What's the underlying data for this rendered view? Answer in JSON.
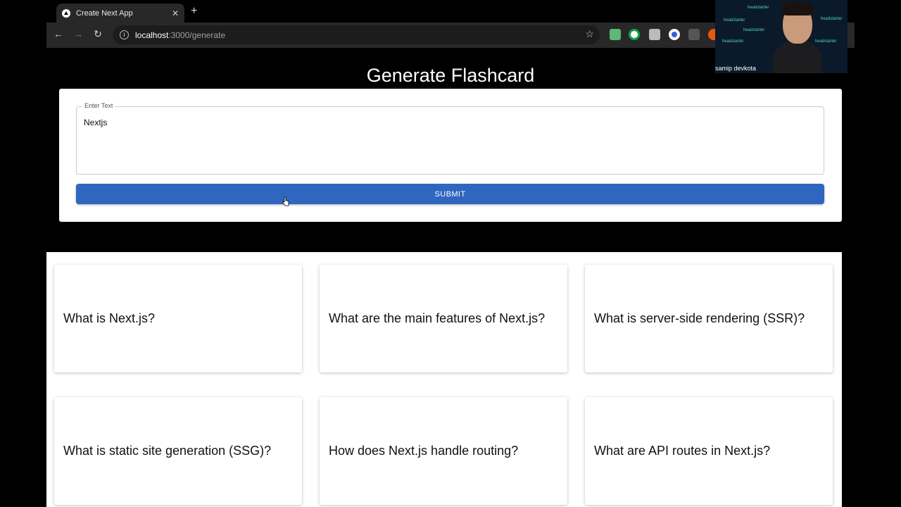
{
  "browser": {
    "tab_title": "Create Next App",
    "tab_close": "✕",
    "new_tab": "+",
    "url_host": "localhost",
    "url_path": ":3000/generate",
    "back": "←",
    "forward": "→",
    "reload": "↻",
    "star": "☆"
  },
  "page": {
    "title": "Generate Flashcard",
    "input_label": "Enter Text",
    "input_value": "Nextjs",
    "submit_label": "SUBMIT"
  },
  "flashcards": [
    "What is Next.js?",
    "What are the main features of Next.js?",
    "What is server-side rendering (SSR)?",
    "What is static site generation (SSG)?",
    "How does Next.js handle routing?",
    "What are API routes in Next.js?"
  ],
  "webcam": {
    "name": "samip devkota",
    "tag": "headstarter"
  }
}
